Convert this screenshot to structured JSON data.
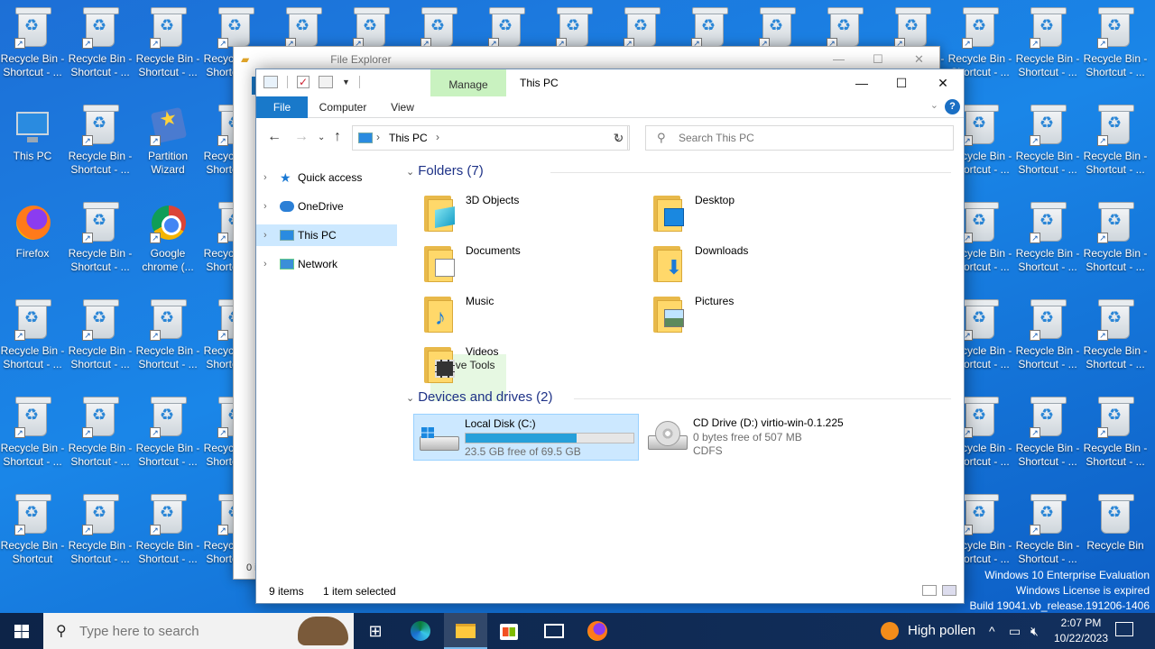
{
  "desktop": {
    "labels": {
      "recycle_shortcut": [
        "Recycle Bin -",
        "Shortcut - ..."
      ],
      "recycle_shortcut_plain": [
        "Recycle Bin -",
        "Shortcut"
      ],
      "recycle_bin": [
        "Recycle Bin",
        ""
      ],
      "this_pc": [
        "This PC",
        ""
      ],
      "partition": [
        "Partition",
        "Wizard"
      ],
      "firefox": [
        "Firefox",
        ""
      ],
      "chrome": [
        "Google",
        "chrome (..."
      ]
    },
    "right_col_labels": [
      "ycle Bin -",
      "rtcut - ..."
    ]
  },
  "bg_window": {
    "title": "File Explorer",
    "tab_letter": "F",
    "footer": "0 i"
  },
  "window": {
    "title": "This PC",
    "manage_label": "Manage",
    "tabs": [
      "File",
      "Computer",
      "View",
      "Drive Tools"
    ],
    "help_icon": "?",
    "address": {
      "crumb": "This PC"
    },
    "search_placeholder": "Search This PC",
    "nav": [
      "Quick access",
      "OneDrive",
      "This PC",
      "Network"
    ],
    "groups": {
      "folders": "Folders (7)",
      "drives": "Devices and drives (2)"
    },
    "folders": [
      {
        "name": "3D Objects",
        "icon": "3d-objects-folder-icon"
      },
      {
        "name": "Desktop",
        "icon": "desktop-folder-icon"
      },
      {
        "name": "Documents",
        "icon": "documents-folder-icon"
      },
      {
        "name": "Downloads",
        "icon": "downloads-folder-icon"
      },
      {
        "name": "Music",
        "icon": "music-folder-icon"
      },
      {
        "name": "Pictures",
        "icon": "pictures-folder-icon"
      },
      {
        "name": "Videos",
        "icon": "videos-folder-icon"
      }
    ],
    "drives": [
      {
        "name": "Local Disk (C:)",
        "free": "23.5 GB free of 69.5 GB",
        "used_fraction": 0.66
      },
      {
        "name": "CD Drive (D:) virtio-win-0.1.225",
        "free": "0 bytes free of 507 MB",
        "fs": "CDFS"
      }
    ],
    "status": {
      "items": "9 items",
      "selected": "1 item selected"
    }
  },
  "watermark": [
    "Windows 10 Enterprise Evaluation",
    "Windows License is expired",
    "Build 19041.vb_release.191206-1406"
  ],
  "taskbar": {
    "search_placeholder": "Type here to search",
    "weather": "High pollen",
    "time": "2:07 PM",
    "date": "10/22/2023"
  },
  "colors": {
    "desktop": "#1a86e8",
    "selection": "#cce8ff",
    "accent": "#1979ca",
    "drive_bar": "#26a0da",
    "manage_tab": "#c9f2c0"
  }
}
